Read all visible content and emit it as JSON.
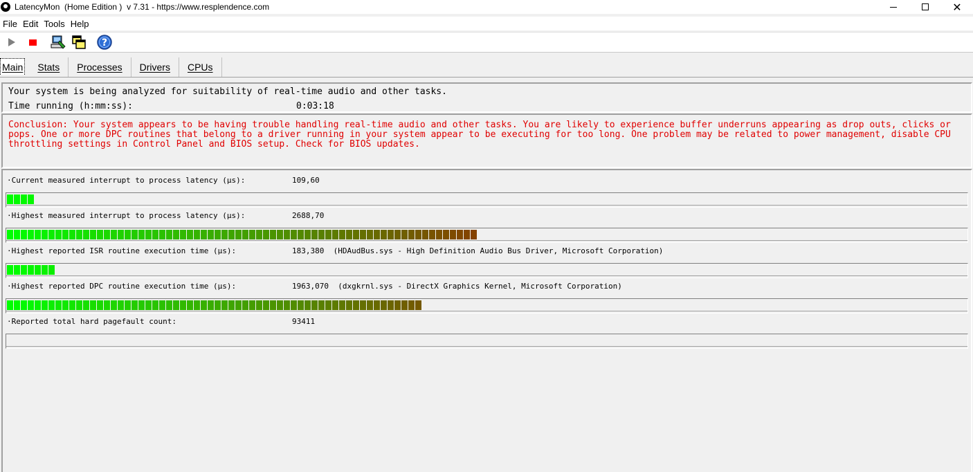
{
  "window": {
    "title": "LatencyMon  (Home Edition )  v 7.31 - https://www.resplendence.com"
  },
  "menu": [
    "File",
    "Edit",
    "Tools",
    "Help"
  ],
  "toolbar": {
    "buttons": [
      "play-icon",
      "stop-icon",
      "computer-icon",
      "windows-icon",
      "help-icon"
    ]
  },
  "tabs": [
    {
      "label": "Main",
      "active": true
    },
    {
      "label": "Stats",
      "active": false
    },
    {
      "label": "Processes",
      "active": false
    },
    {
      "label": "Drivers",
      "active": false
    },
    {
      "label": "CPUs",
      "active": false
    }
  ],
  "info": {
    "line1": "Your system is being analyzed for suitability of real-time audio and other tasks.",
    "time_label": "Time running (h:mm:ss):",
    "time_value": "0:03:18"
  },
  "conclusion": "Conclusion: Your system appears to be having trouble handling real-time audio and other tasks. You are likely to experience buffer underruns appearing as drop outs, clicks or pops. One or more DPC routines that belong to a driver running in your system appear to be executing for too long. One problem may be related to power management, disable CPU throttling settings in Control Panel and BIOS setup. Check for BIOS updates.",
  "stats": [
    {
      "label": "·Current measured interrupt to process latency (µs):",
      "value": "109,60",
      "bar_segments": 4,
      "has_bar": true
    },
    {
      "label": "·Highest measured interrupt to process latency (µs):",
      "value": "2688,70",
      "bar_segments": 68,
      "has_bar": true
    },
    {
      "label": "·Highest reported ISR routine execution time (µs):",
      "value": "183,380  (HDAudBus.sys - High Definition Audio Bus Driver, Microsoft Corporation)",
      "bar_segments": 7,
      "has_bar": true
    },
    {
      "label": "·Highest reported DPC routine execution time (µs):",
      "value": "1963,070  (dxgkrnl.sys - DirectX Graphics Kernel, Microsoft Corporation)",
      "bar_segments": 60,
      "has_bar": true
    },
    {
      "label": "·Reported total hard pagefault count:",
      "value": "93411",
      "bar_segments": 0,
      "has_bar": true
    }
  ],
  "colors": {
    "bar_start": "#00ff00",
    "bar_end": "#8a3a00",
    "conclusion_text": "#e00000"
  }
}
